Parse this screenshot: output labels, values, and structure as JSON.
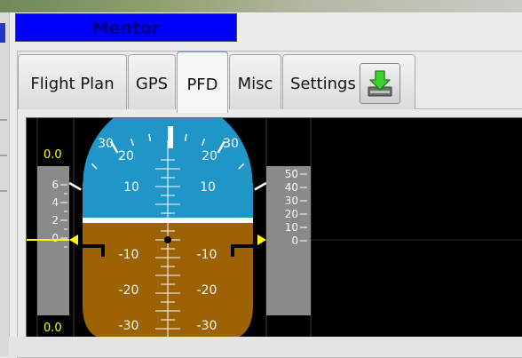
{
  "window": {
    "title": "Mentor"
  },
  "tabs": [
    {
      "label": "Flight Plan",
      "active": false
    },
    {
      "label": "GPS",
      "active": false
    },
    {
      "label": "PFD",
      "active": true
    },
    {
      "label": "Misc",
      "active": false
    },
    {
      "label": "Settings",
      "active": false
    }
  ],
  "toolbar": {
    "download_icon": "download-arrow-icon"
  },
  "pfd": {
    "left_tape": {
      "top_readout": "0.0",
      "bottom_readout": "0.0",
      "labels": [
        "6",
        "4",
        "2",
        "0"
      ]
    },
    "attitude": {
      "bank_labels": [
        "30",
        "20",
        "20",
        "30"
      ],
      "pitch_up_labels": [
        "10",
        "10"
      ],
      "pitch_down_labels": [
        "-10",
        "-10",
        "-20",
        "-20",
        "-30",
        "-30"
      ]
    },
    "right_tape": {
      "labels": [
        "50",
        "40",
        "30",
        "20",
        "10",
        "0"
      ]
    }
  },
  "colors": {
    "sky": "#1f95c8",
    "ground": "#9c6204",
    "title_bar": "#0000ff",
    "yellow": "#ffff00"
  }
}
